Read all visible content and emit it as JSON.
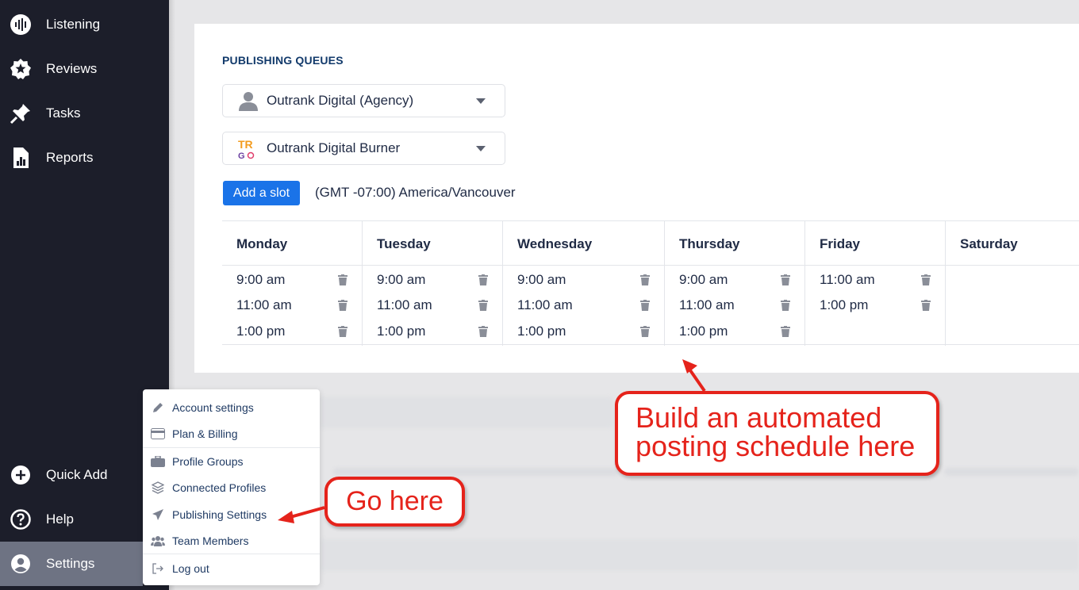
{
  "sidebar": {
    "items": [
      {
        "label": "Listening",
        "icon": "listening-icon"
      },
      {
        "label": "Reviews",
        "icon": "star-badge-icon"
      },
      {
        "label": "Tasks",
        "icon": "pin-icon"
      },
      {
        "label": "Reports",
        "icon": "report-icon"
      },
      {
        "label": "Quick Add",
        "icon": "plus-circle-icon"
      },
      {
        "label": "Help",
        "icon": "help-circle-icon"
      },
      {
        "label": "Settings",
        "icon": "user-circle-icon"
      }
    ]
  },
  "publishing": {
    "title": "PUBLISHING QUEUES",
    "agency_select": "Outrank Digital (Agency)",
    "profile_select": "Outrank Digital Burner",
    "profile_logo_text_top": "TR",
    "profile_logo_text_bottom": "G",
    "add_slot_label": "Add a slot",
    "timezone": "(GMT -07:00) America/Vancouver",
    "days": [
      {
        "name": "Monday",
        "slots": [
          "9:00 am",
          "11:00 am",
          "1:00 pm"
        ]
      },
      {
        "name": "Tuesday",
        "slots": [
          "9:00 am",
          "11:00 am",
          "1:00 pm"
        ]
      },
      {
        "name": "Wednesday",
        "slots": [
          "9:00 am",
          "11:00 am",
          "1:00 pm"
        ]
      },
      {
        "name": "Thursday",
        "slots": [
          "9:00 am",
          "11:00 am",
          "1:00 pm"
        ]
      },
      {
        "name": "Friday",
        "slots": [
          "11:00 am",
          "1:00 pm"
        ]
      },
      {
        "name": "Saturday",
        "slots": []
      }
    ]
  },
  "settings_menu": {
    "items": [
      {
        "label": "Account settings",
        "icon": "pencil-icon"
      },
      {
        "label": "Plan & Billing",
        "icon": "credit-card-icon"
      },
      {
        "label": "Profile Groups",
        "icon": "briefcase-icon"
      },
      {
        "label": "Connected Profiles",
        "icon": "layers-icon"
      },
      {
        "label": "Publishing Settings",
        "icon": "paper-plane-icon"
      },
      {
        "label": "Team Members",
        "icon": "team-icon"
      },
      {
        "label": "Log out",
        "icon": "logout-icon"
      }
    ]
  },
  "annotations": {
    "callout_schedule_line1": "Build an automated",
    "callout_schedule_line2": "posting schedule here",
    "callout_go": "Go here"
  },
  "colors": {
    "sidebar_bg": "#1c1e2a",
    "accent_blue": "#1a73e8",
    "callout_red": "#e5231b",
    "title_navy": "#123a6b"
  }
}
